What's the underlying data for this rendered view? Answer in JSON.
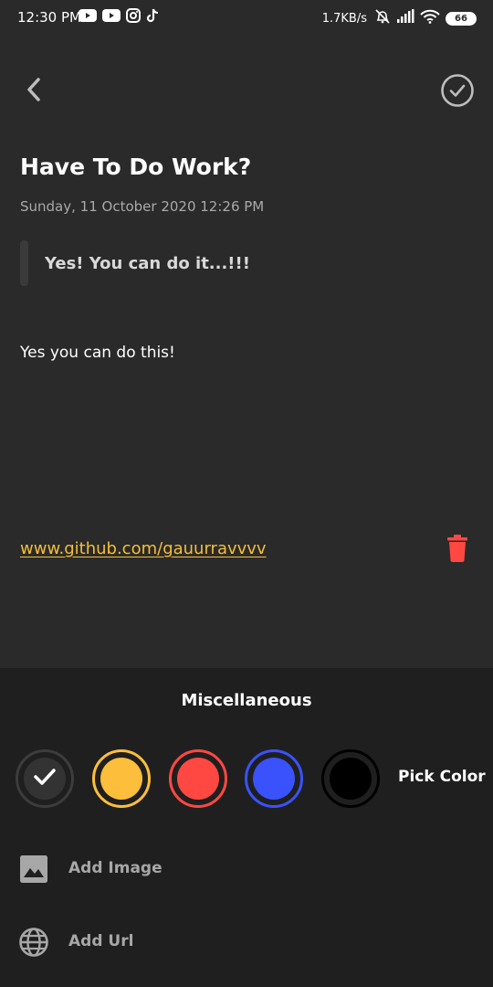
{
  "status_bar": {
    "time": "12:30 PM",
    "network_speed": "1.7KB/s",
    "battery_level": "66",
    "app_icons": [
      "youtube-icon",
      "youtube-icon",
      "instagram-icon",
      "tiktok-icon"
    ],
    "system_icons": [
      "alarm-off-icon",
      "signal-icon",
      "wifi-icon",
      "battery-icon"
    ]
  },
  "toolbar": {
    "back_icon": "chevron-left-icon",
    "save_icon": "check-circle-icon"
  },
  "note": {
    "title": "Have To Do Work?",
    "date_time": "Sunday, 11 October 2020 12:26 PM",
    "subtitle": "Yes! You can do it...!!!",
    "body": "Yes you can do this!",
    "url": "www.github.com/gauurravvvv",
    "delete_icon": "trash-icon"
  },
  "miscellaneous": {
    "title": "Miscellaneous",
    "colors": [
      {
        "name": "default",
        "hex": "#333333",
        "selected": true
      },
      {
        "name": "yellow",
        "hex": "#fdbe3b",
        "selected": false
      },
      {
        "name": "red",
        "hex": "#ff4842",
        "selected": false
      },
      {
        "name": "blue",
        "hex": "#3a52fc",
        "selected": false
      },
      {
        "name": "black",
        "hex": "#000000",
        "selected": false
      }
    ],
    "pick_color_label": "Pick Color",
    "add_image_label": "Add Image",
    "add_url_label": "Add Url"
  },
  "theme": {
    "background": "#2a2a2a",
    "panel_background": "#1f1f1f",
    "link_color": "#f5be39",
    "delete_color": "#ff4842"
  }
}
